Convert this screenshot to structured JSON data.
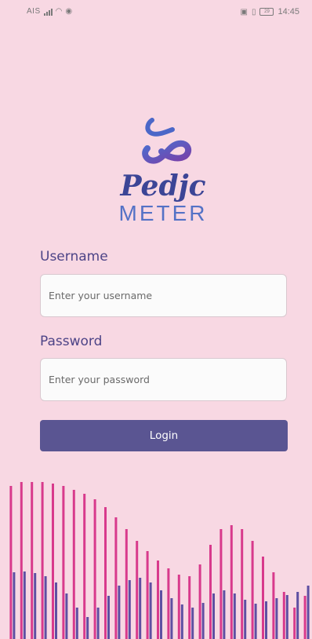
{
  "status_bar": {
    "carrier": "AIS",
    "time": "14:45",
    "battery": "29",
    "icons": [
      "signal-icon",
      "wifi-icon",
      "eye-icon",
      "nfc-icon",
      "vibrate-icon",
      "battery-icon"
    ]
  },
  "logo": {
    "word_1": "Pedjc",
    "word_2": "METER"
  },
  "login_form": {
    "username_label": "Username",
    "username_placeholder": "Enter your username",
    "username_value": "",
    "password_label": "Password",
    "password_placeholder": "Enter your password",
    "password_value": "",
    "login_label": "Login"
  },
  "colors": {
    "background": "#f8d8e3",
    "primary": "#5a5592",
    "wave_purple": "#5e4fa2",
    "wave_pink": "#d83a8c"
  }
}
